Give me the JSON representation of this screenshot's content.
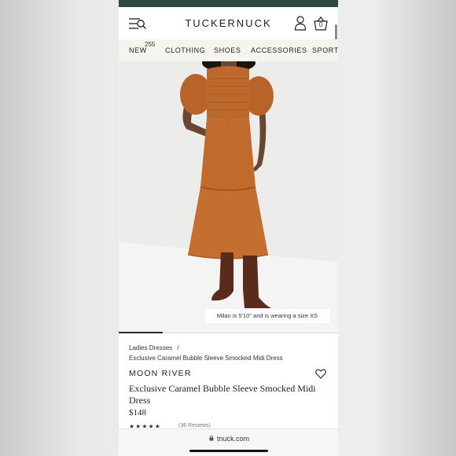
{
  "header": {
    "brand": "TUCKERNUCK",
    "bag_count": "0"
  },
  "nav": {
    "items": [
      "NEW",
      "CLOTHING",
      "SHOES",
      "ACCESSORIES",
      "SPORT"
    ],
    "new_badge": "255"
  },
  "hero": {
    "caption": "Milan is 5'10\" and is wearing a size XS"
  },
  "breadcrumb": {
    "parent": "Ladies Dresses",
    "separator": "/",
    "current": "Exclusive Caramel Bubble Sleeve Smocked Midi Dress"
  },
  "product": {
    "designer": "MOON RIVER",
    "title": "Exclusive Caramel Bubble Sleeve Smocked Midi Dress",
    "price": "$148",
    "rating_stars": "★★★★★",
    "reviews": "(36 Reviews)"
  },
  "browser": {
    "url": "tnuck.com"
  },
  "colors": {
    "topbar": "#2f4a3d",
    "nav_bg": "#f6f4ee",
    "dress": "#c06a2c",
    "boots": "#5a2a1c"
  },
  "icons": [
    "menu-search-icon",
    "account-icon",
    "shopping-bag-icon",
    "heart-icon",
    "lock-icon"
  ]
}
